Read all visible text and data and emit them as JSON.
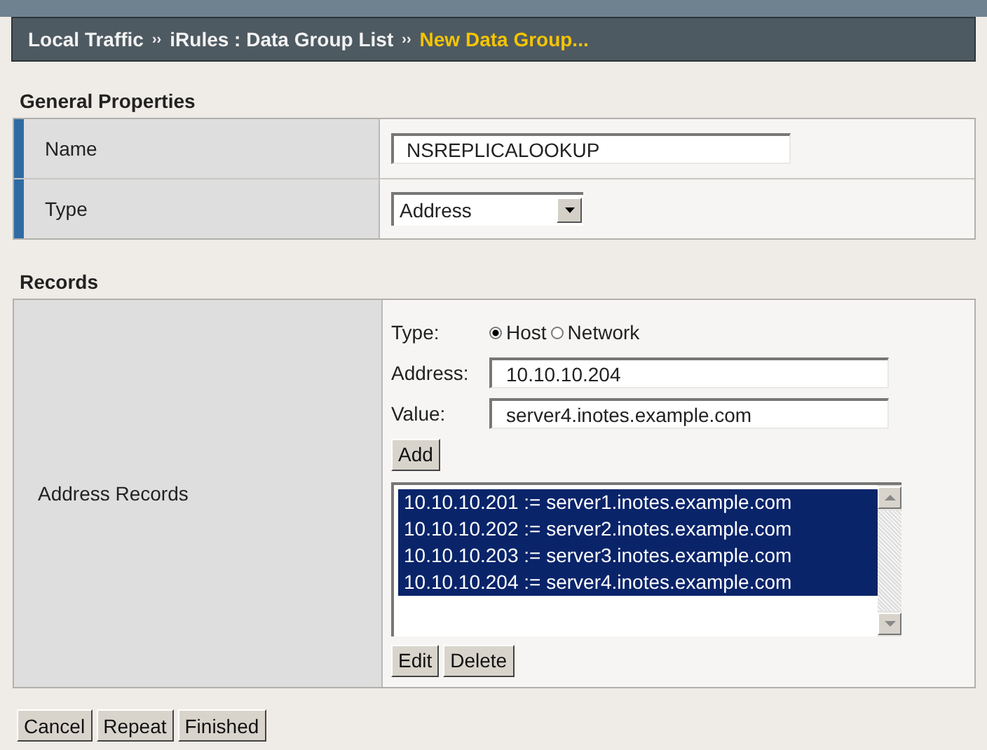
{
  "breadcrumb": [
    {
      "label": "Local Traffic",
      "current": false
    },
    {
      "label": "iRules : Data Group List",
      "current": false
    },
    {
      "label": "New Data Group...",
      "current": true
    }
  ],
  "separator": "››",
  "general_properties": {
    "title": "General Properties",
    "rows": [
      {
        "label": "Name",
        "kind": "text",
        "value": "NSREPLICALOOKUP"
      },
      {
        "label": "Type",
        "kind": "select",
        "value": "Address"
      }
    ]
  },
  "records": {
    "title": "Records",
    "label": "Address Records",
    "type_label": "Type:",
    "type_options": [
      {
        "label": "Host",
        "selected": true
      },
      {
        "label": "Network",
        "selected": false
      }
    ],
    "address_label": "Address:",
    "address_value": "10.10.10.204",
    "value_label": "Value:",
    "value_value": "server4.inotes.example.com",
    "add_button": "Add",
    "list": [
      {
        "text": "10.10.10.201 := server1.inotes.example.com",
        "selected": true
      },
      {
        "text": "10.10.10.202 := server2.inotes.example.com",
        "selected": true
      },
      {
        "text": "10.10.10.203 := server3.inotes.example.com",
        "selected": true
      },
      {
        "text": "10.10.10.204 := server4.inotes.example.com",
        "selected": true
      }
    ],
    "list_buttons": [
      "Edit",
      "Delete"
    ]
  },
  "buttons": [
    "Cancel",
    "Repeat",
    "Finished"
  ]
}
